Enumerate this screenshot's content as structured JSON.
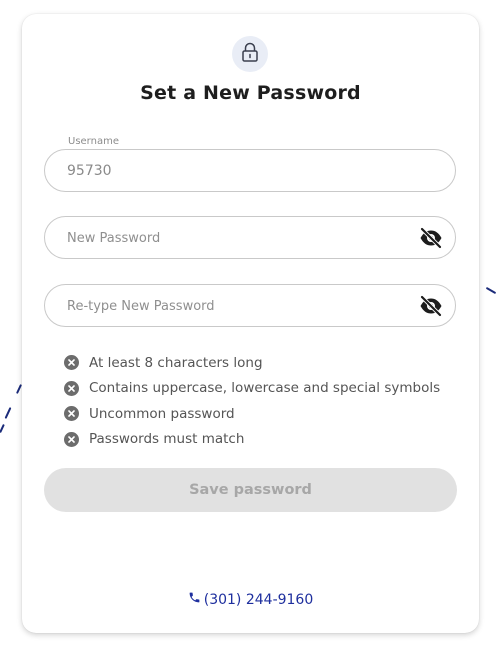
{
  "title": "Set a New Password",
  "username": {
    "label": "Username",
    "value": "95730"
  },
  "new_password": {
    "placeholder": "New Password",
    "icon": "eye-slash-icon"
  },
  "retype_password": {
    "placeholder": "Re-type New Password",
    "icon": "eye-slash-icon"
  },
  "requirements": [
    {
      "label": "At least 8 characters long",
      "status": "unmet"
    },
    {
      "label": "Contains uppercase, lowercase and special symbols",
      "status": "unmet"
    },
    {
      "label": "Uncommon password",
      "status": "unmet"
    },
    {
      "label": "Passwords must match",
      "status": "unmet"
    }
  ],
  "save_button": {
    "label": "Save password",
    "disabled": true
  },
  "phone": {
    "number": "(301) 244-9160",
    "icon": "phone-icon"
  },
  "colors": {
    "accent": "#1e2f9e",
    "disabled_button": "#e1e1e1",
    "unmet_icon": "#6c6c6c",
    "lock_bg": "#e9edf6"
  }
}
